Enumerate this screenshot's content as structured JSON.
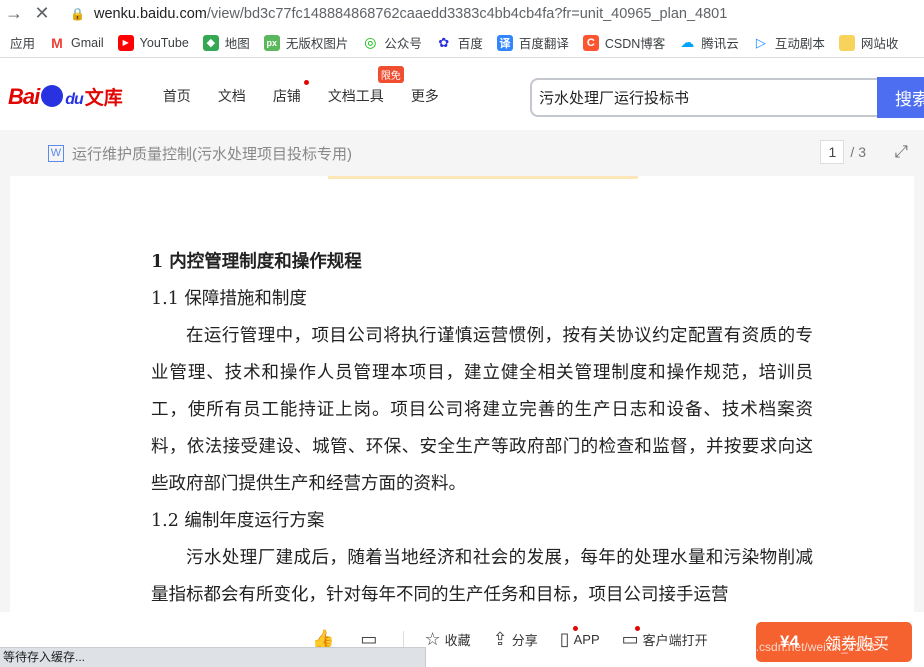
{
  "browser": {
    "url_host": "wenku.baidu.com",
    "url_path": "/view/bd3c77fc148884868762caaedd3383c4bb4cb4fa?fr=unit_40965_plan_4801",
    "bookmarks": [
      "应用",
      "Gmail",
      "YouTube",
      "地图",
      "无版权图片",
      "公众号",
      "百度",
      "百度翻译",
      "CSDN博客",
      "腾讯云",
      "互动剧本",
      "网站收"
    ]
  },
  "header": {
    "logo_text": "Bai",
    "logo_du": "du",
    "logo_suffix": "文库",
    "nav": [
      "首页",
      "文档",
      "店铺",
      "文档工具",
      "更多"
    ],
    "tool_badge": "限免",
    "search_value": "污水处理厂运行投标书",
    "search_button": "搜索"
  },
  "docbar": {
    "file_icon": "W",
    "title": "运行维护质量控制(污水处理项目投标专用)",
    "current_page": "1",
    "total_pages": "/ 3"
  },
  "content": {
    "heading": "1 内控管理制度和操作规程",
    "sub1": "1.1  保障措施和制度",
    "para1": "在运行管理中，项目公司将执行谨慎运营惯例，按有关协议约定配置有资质的专业管理、技术和操作人员管理本项目，建立健全相关管理制度和操作规范，培训员工，使所有员工能持证上岗。项目公司将建立完善的生产日志和设备、技术档案资料，依法接受建设、城管、环保、安全生产等政府部门的检查和监督，并按要求向这些政府部门提供生产和经营方面的资料。",
    "sub2": "1.2 编制年度运行方案",
    "para2": "污水处理厂建成后，随着当地经济和社会的发展，每年的处理水量和污染物削减量指标都会有所变化，针对每年不同的生产任务和目标，项目公司接手运营"
  },
  "toolbar": {
    "collect": "收藏",
    "share": "分享",
    "app": "APP",
    "client": "客户端打开",
    "price": "¥4",
    "buy": "领券购买"
  },
  "status": {
    "text": "等待存入缓存..."
  },
  "watermark": "https://blog.csdn.net/weixin_4103"
}
